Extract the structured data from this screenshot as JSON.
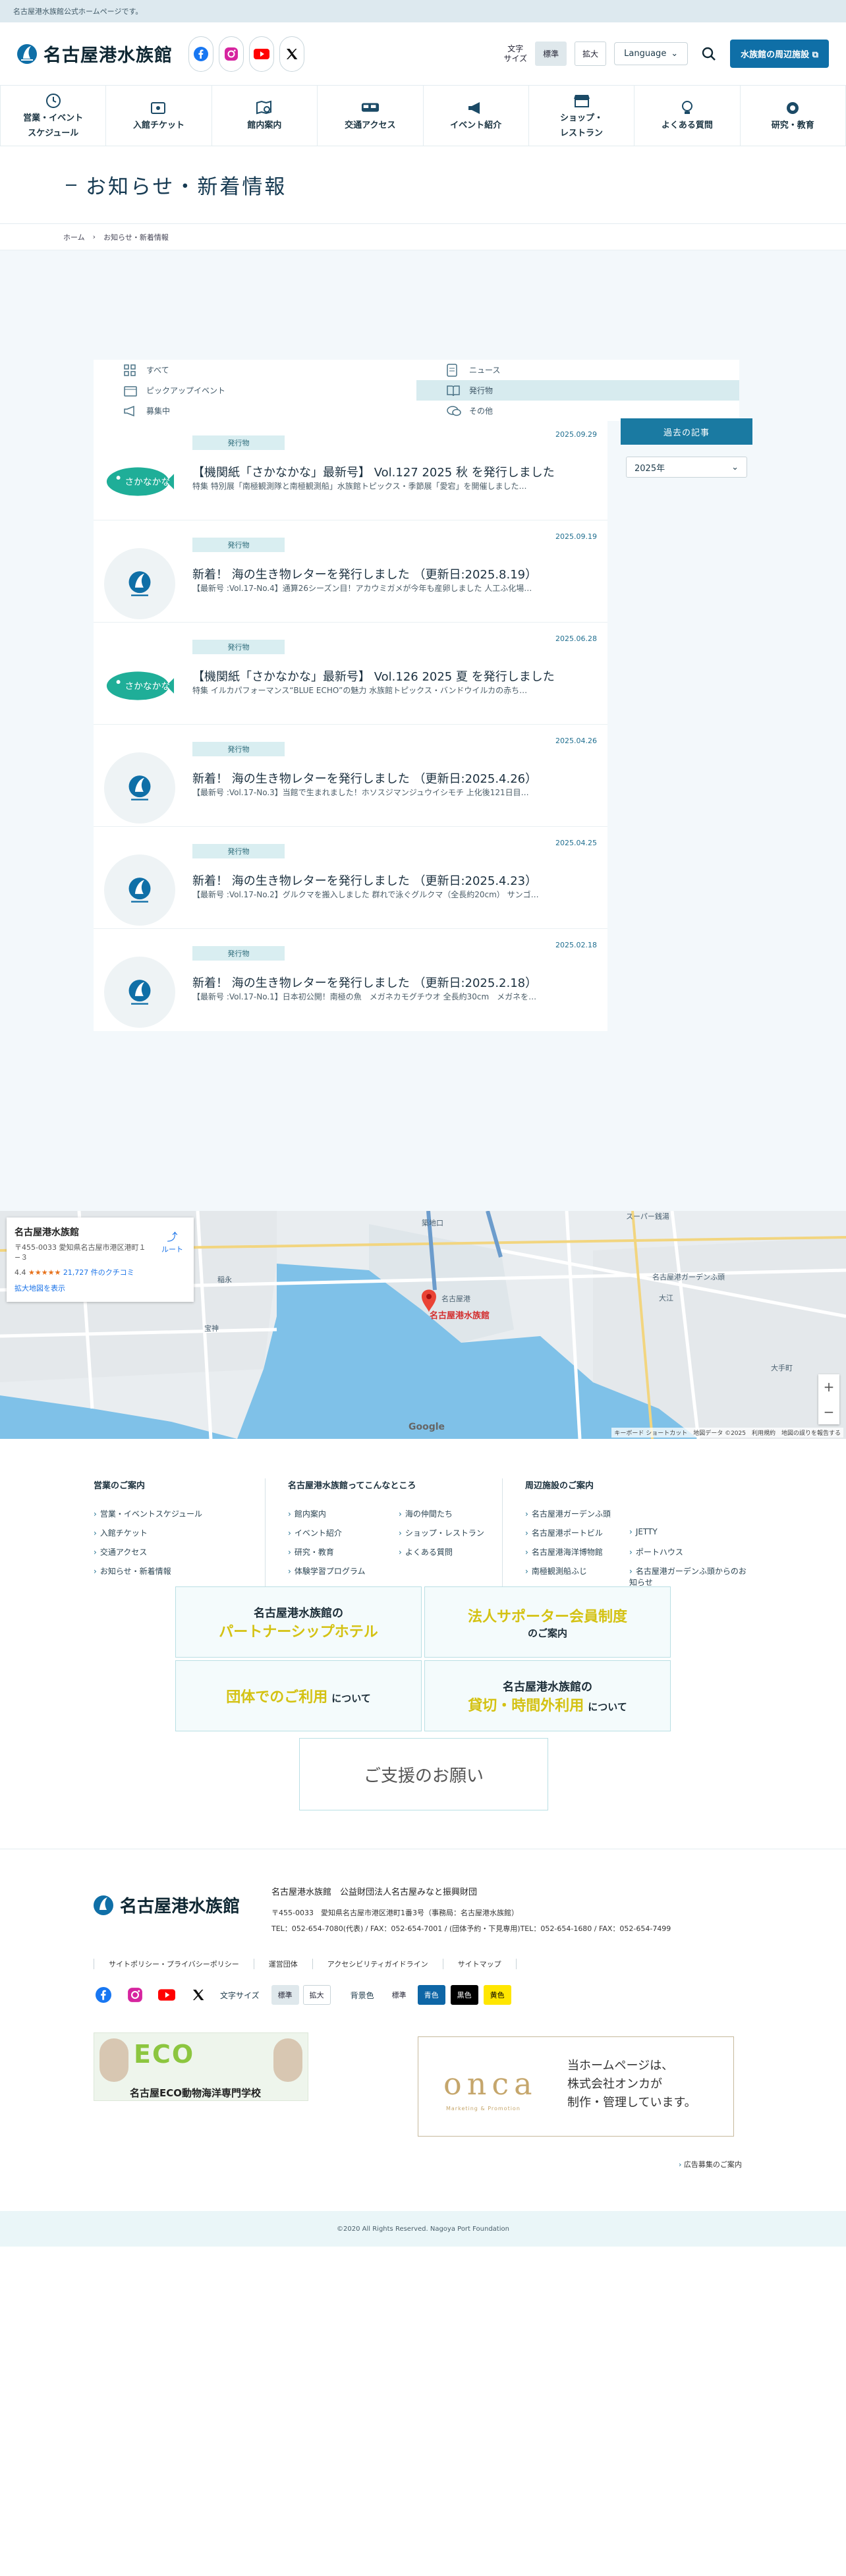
{
  "topbar": {
    "text": "名古屋港水族館公式ホームページです。"
  },
  "header": {
    "logo_text": "名古屋港水族館",
    "text_size_label_1": "文字",
    "text_size_label_2": "サイズ",
    "size_standard": "標準",
    "size_large": "拡大",
    "language": "Language",
    "facility_button": "水族館の周辺施設"
  },
  "gnav": [
    {
      "label1": "営業・イベント",
      "label2": "スケジュール",
      "icon": "clock-icon"
    },
    {
      "label1": "入館チケット",
      "label2": "",
      "icon": "ticket-icon"
    },
    {
      "label1": "館内案内",
      "label2": "",
      "icon": "map-search-icon"
    },
    {
      "label1": "交通アクセス",
      "label2": "",
      "icon": "bus-icon"
    },
    {
      "label1": "イベント紹介",
      "label2": "",
      "icon": "megaphone-icon"
    },
    {
      "label1": "ショップ・",
      "label2": "レストラン",
      "icon": "shop-icon"
    },
    {
      "label1": "よくある質問",
      "label2": "",
      "icon": "bulb-icon"
    },
    {
      "label1": "研究・教育",
      "label2": "",
      "icon": "microscope-icon"
    }
  ],
  "page_title": "お知らせ・新着情報",
  "breadcrumb": {
    "home": "ホーム",
    "current": "お知らせ・新着情報"
  },
  "filters": [
    {
      "label": "すべて",
      "icon": "grid-icon",
      "selected": false
    },
    {
      "label": "ニュース",
      "icon": "document-icon",
      "selected": false
    },
    {
      "label": "ピックアップイベント",
      "icon": "calendar-icon",
      "selected": false
    },
    {
      "label": "発行物",
      "icon": "book-icon",
      "selected": true
    },
    {
      "label": "募集中",
      "icon": "megaphone-icon",
      "selected": false
    },
    {
      "label": "その他",
      "icon": "chat-icon",
      "selected": false
    }
  ],
  "news": [
    {
      "category": "発行物",
      "date": "2025.09.29",
      "title": "【機関紙「さかなかな」最新号】 Vol.127 2025 秋 を発行しました",
      "desc": "特集 特別展「南極観測隊と南極観測船」水族館トピックス・季節展「愛宕」を開催しました…",
      "thumb": "sakanakana"
    },
    {
      "category": "発行物",
      "date": "2025.09.19",
      "title": "新着！ 海の生き物レターを発行しました （更新日:2025.8.19）",
      "desc": "【最新号 :Vol.17-No.4】通算26シーズン目！アカウミガメが今年も産卵しました 人工ふ化場…",
      "thumb": "logo"
    },
    {
      "category": "発行物",
      "date": "2025.06.28",
      "title": "【機関紙「さかなかな」最新号】 Vol.126 2025 夏 を発行しました",
      "desc": "特集 イルカパフォーマンス“BLUE ECHO”の魅力 水族館トピックス・バンドウイルカの赤ち…",
      "thumb": "sakanakana"
    },
    {
      "category": "発行物",
      "date": "2025.04.26",
      "title": "新着！ 海の生き物レターを発行しました （更新日:2025.4.26）",
      "desc": "【最新号 :Vol.17-No.3】当館で生まれました！ホソスジマンジュウイシモチ 上化後121日目…",
      "thumb": "logo"
    },
    {
      "category": "発行物",
      "date": "2025.04.25",
      "title": "新着！ 海の生き物レターを発行しました （更新日:2025.4.23）",
      "desc": "【最新号 :Vol.17-No.2】グルクマを搬入しました 群れで泳ぐグルクマ（全長約20cm） サンゴ…",
      "thumb": "logo"
    },
    {
      "category": "発行物",
      "date": "2025.02.18",
      "title": "新着！ 海の生き物レターを発行しました （更新日:2025.2.18）",
      "desc": "【最新号 :Vol.17-No.1】日本初公開！南極の魚　メガネカモグチウオ 全長約30cm　メガネを…",
      "thumb": "logo"
    }
  ],
  "thumb_text": "さかなかな",
  "side": {
    "archive_button": "過去の記事",
    "year": "2025年"
  },
  "map": {
    "title": "名古屋港水族館",
    "address": "〒455-0033 愛知県名古屋市港区港町１−３",
    "rating": "4.4",
    "stars": "★★★★★",
    "reviews": "21,727 件のクチコミ",
    "larger_map": "拡大地図を表示",
    "route": "ルート",
    "pin_label": "名古屋港水族館",
    "attribution": "キーボード ショートカット　地図データ ©2025　利用規約　地図の誤りを報告する",
    "google": "Google",
    "places": [
      "築地口",
      "名古屋港",
      "大手町",
      "稲永",
      "宝神",
      "大江",
      "名古屋港ガーデンふ頭",
      "スーパー銭湯"
    ]
  },
  "footer_links": {
    "col1": {
      "title": "営業のご案内",
      "items": [
        "営業・イベントスケジュール",
        "入館チケット",
        "交通アクセス",
        "お知らせ・新着情報"
      ]
    },
    "col2": {
      "title": "名古屋港水族館ってこんなところ",
      "items": [
        "館内案内",
        "海の仲間たち",
        "イベント紹介",
        "ショップ・レストラン",
        "研究・教育",
        "よくある質問",
        "体験学習プログラム"
      ]
    },
    "col3": {
      "title": "周辺施設のご案内",
      "items": [
        "名古屋港ガーデンふ頭",
        "名古屋港ポートビル",
        "JETTY",
        "名古屋港海洋博物館",
        "ポートハウス",
        "南極観測船ふじ",
        "名古屋港ガーデンふ頭からのお知らせ"
      ]
    }
  },
  "banners": {
    "b1_l1": "名古屋港水族館の",
    "b1_l2": "パートナーシップホテル",
    "b2_l1": "法人サポーター会員制度",
    "b2_l2": "のご案内",
    "b3_l1": "団体でのご利用",
    "b3_l2": "について",
    "b4_l1": "名古屋港水族館の",
    "b4_l2": "貸切・時間外利用",
    "b4_l3": "について",
    "b5_l1": "ご支援のお願い"
  },
  "footer": {
    "logo_text": "名古屋港水族館",
    "org": "名古屋港水族館　公益財団法人名古屋みなと振興財団",
    "address": "〒455-0033　愛知県名古屋市港区港町1番3号（事務局：名古屋港水族館）",
    "tel": "TEL：052-654-7080(代表) / FAX：052-654-7001 / (団体予約・下見専用)TEL：052-654-1680 / FAX：052-654-7499",
    "menu": [
      "サイトポリシー・プライバシーポリシー",
      "運営団体",
      "アクセシビリティガイドライン",
      "サイトマップ"
    ],
    "text_size": "文字サイズ",
    "standard": "標準",
    "large": "拡大",
    "bg_color": "背景色",
    "bg_standard": "標準",
    "bg_blue": "青色",
    "bg_black": "黒色",
    "bg_yellow": "黄色",
    "eco_title": "ECO",
    "eco_name": "名古屋ECO動物海洋専門学校",
    "onca_logo": "onca",
    "onca_sub": "Marketing & Promotion",
    "onca_text_1": "当ホームページは、",
    "onca_text_2": "株式会社オンカが",
    "onca_text_3": "制作・管理しています。",
    "ad_link": "広告募集のご案内",
    "copyright": "©2020 All Rights Reserved. Nagoya Port Foundation"
  }
}
